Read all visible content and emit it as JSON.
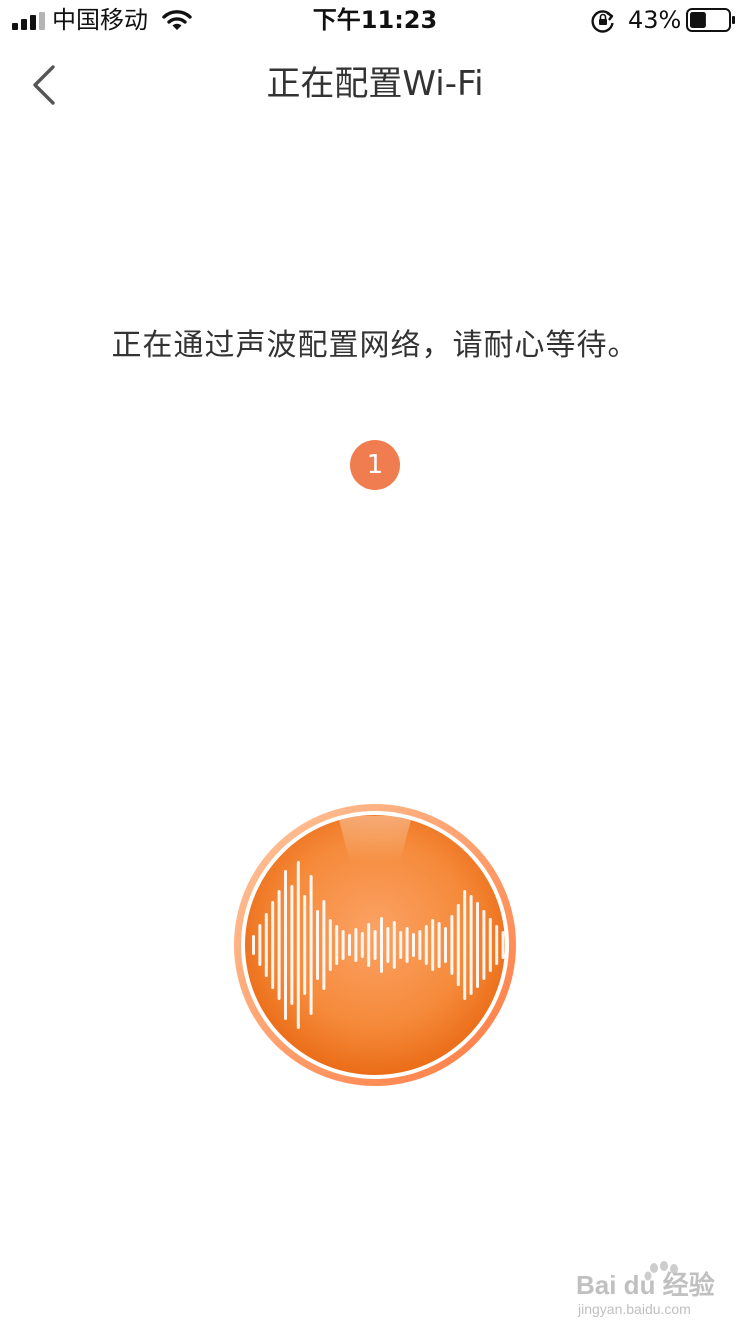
{
  "status_bar": {
    "carrier": "中国移动",
    "time": "下午11:23",
    "battery_percent": "43%",
    "battery_level": 0.43,
    "icons": [
      "signal-icon",
      "wifi-icon",
      "rotation-lock-icon",
      "battery-icon"
    ]
  },
  "nav": {
    "title": "正在配置Wi-Fi",
    "back_icon": "chevron-left-icon"
  },
  "main": {
    "instruction": "正在通过声波配置网络，请耐心等待。",
    "step_number": "1",
    "sound_button_icon": "sound-wave-icon"
  },
  "watermark": {
    "brand": "Bai du 经验",
    "url": "jingyan.baidu.com"
  },
  "colors": {
    "accent": "#f07d4f",
    "orange_dark": "#ef6a14",
    "orange_light": "#ffb27a",
    "text": "#333333"
  }
}
